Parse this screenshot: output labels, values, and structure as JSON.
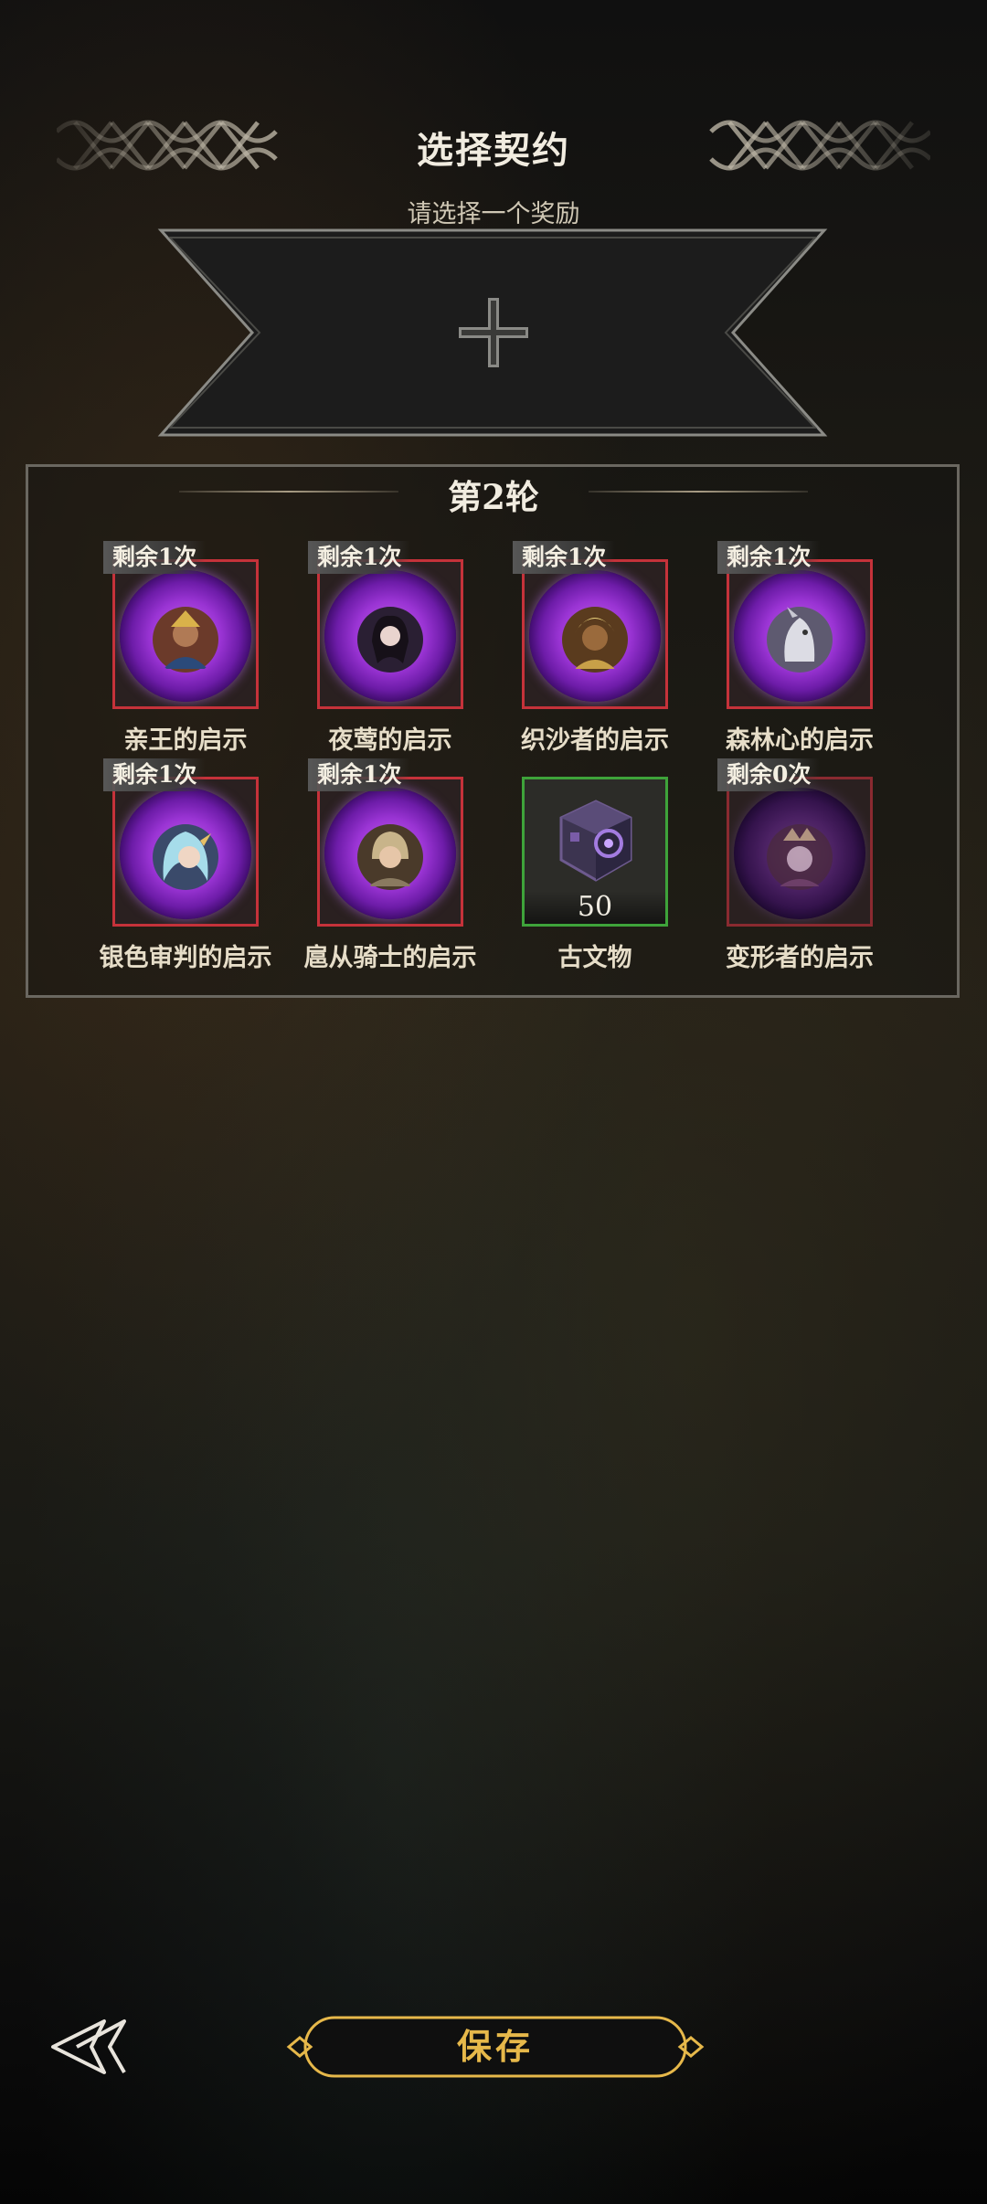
{
  "header": {
    "title": "选择契约",
    "subtitle": "请选择一个奖励"
  },
  "reward_slot": {
    "icon": "plus-icon"
  },
  "round": {
    "title": "第2轮",
    "cards": [
      {
        "badge": "剩余1次",
        "label": "亲王的启示",
        "icon": "prince-portrait-icon",
        "border": "#c5323a"
      },
      {
        "badge": "剩余1次",
        "label": "夜莺的启示",
        "icon": "nightingale-portrait-icon",
        "border": "#c5323a"
      },
      {
        "badge": "剩余1次",
        "label": "织沙者的启示",
        "icon": "sandweaver-portrait-icon",
        "border": "#c5323a"
      },
      {
        "badge": "剩余1次",
        "label": "森林心的启示",
        "icon": "forestheart-portrait-icon",
        "border": "#c5323a"
      },
      {
        "badge": "剩余1次",
        "label": "银色审判的启示",
        "icon": "silver-judgment-portrait-icon",
        "border": "#c5323a"
      },
      {
        "badge": "剩余1次",
        "label": "扈从骑士的启示",
        "icon": "squire-knight-portrait-icon",
        "border": "#c5323a"
      },
      {
        "badge": "",
        "label": "古文物",
        "icon": "relic-cube-icon",
        "count": "50",
        "border": "#3ea33a"
      },
      {
        "badge": "剩余0次",
        "label": "变形者的启示",
        "icon": "shapeshifter-portrait-icon",
        "border": "#8a2a30"
      }
    ]
  },
  "footer": {
    "save_label": "保存",
    "back_icon": "back-arrow-icon",
    "accent": "#e6b84a"
  }
}
